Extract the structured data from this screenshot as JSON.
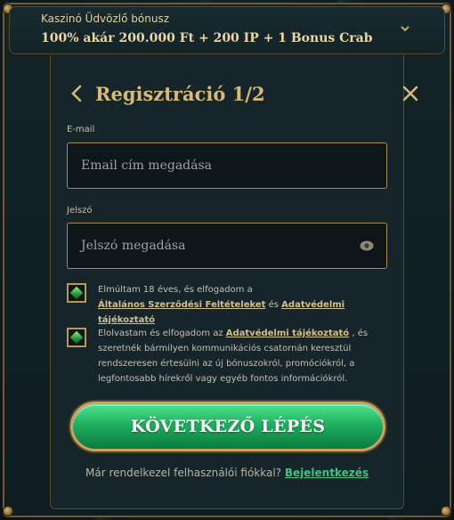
{
  "bonus": {
    "subtitle": "Kaszinó Üdvözlő bónusz",
    "title": "100% akár 200.000 Ft + 200 IP + 1 Bonus Crab",
    "expand_icon": "chevron-down-icon"
  },
  "modal": {
    "title": "Regisztráció 1/2",
    "back_icon": "chevron-left-icon",
    "close_icon": "close-icon"
  },
  "email": {
    "label": "E-mail",
    "placeholder": "Email cím megadása",
    "value": ""
  },
  "password": {
    "label": "Jelszó",
    "placeholder": "Jelszó megadása",
    "value": "",
    "toggle_icon": "eye-icon"
  },
  "consent_terms": {
    "checked": true,
    "text_before": "Elmúltam 18 éves, és elfogadom a",
    "terms_link": "Általános Szerződési Feltételeket",
    "conjunction": " és ",
    "privacy_link": "Adatvédelmi tájékoztató"
  },
  "consent_marketing": {
    "checked": true,
    "text_before": "Elolvastam és elfogadom az ",
    "privacy_link": "Adatvédelmi tájékoztató",
    "text_after": " , és szeretnék bármilyen kommunikációs csatornán keresztül rendszeresen értesülni az új bónuszokról, promóciókról, a legfontosabb hírekről vagy egyéb fontos információkról."
  },
  "next_button": {
    "label": "KÖVETKEZŐ LÉPÉS"
  },
  "footer": {
    "question": "Már rendelkezel felhasználói fiókkal? ",
    "login_link": "Bejelentkezés"
  },
  "colors": {
    "gold": "#d8b97a",
    "green_button": "#1fb060",
    "login_link": "#3fc281",
    "background": "#132326"
  }
}
